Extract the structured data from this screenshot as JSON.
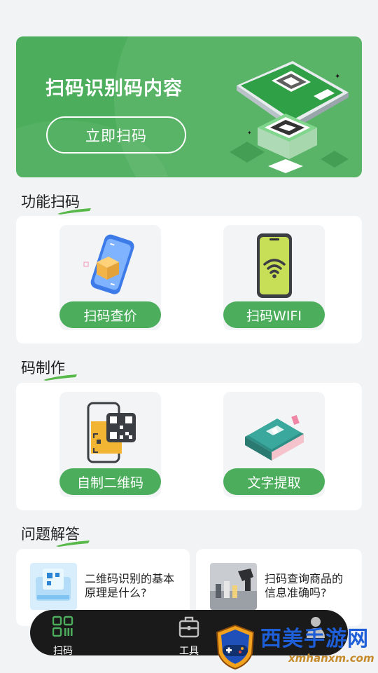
{
  "banner": {
    "title": "扫码识别码内容",
    "button": "立即扫码"
  },
  "sections": {
    "features_title": "功能扫码",
    "make_title": "码制作",
    "qa_title": "问题解答"
  },
  "features": [
    {
      "label": "扫码查价",
      "icon": "phone-box-icon"
    },
    {
      "label": "扫码WIFI",
      "icon": "wifi-phone-icon"
    }
  ],
  "make": [
    {
      "label": "自制二维码",
      "icon": "qr-phone-icon"
    },
    {
      "label": "文字提取",
      "icon": "book-icon"
    }
  ],
  "qa": [
    {
      "question": "二维码识别的基本原理是什么?"
    },
    {
      "question": "扫码查询商品的信息准确吗?"
    }
  ],
  "nav": {
    "scan_label": "扫码",
    "tools_label": "工具"
  },
  "watermark": {
    "text": "西美手游网",
    "url": "xmhanxm.com"
  },
  "colors": {
    "brand_green": "#4cae5c",
    "nav_bg": "#1a1a1a",
    "page_bg": "#f2f3f5"
  }
}
